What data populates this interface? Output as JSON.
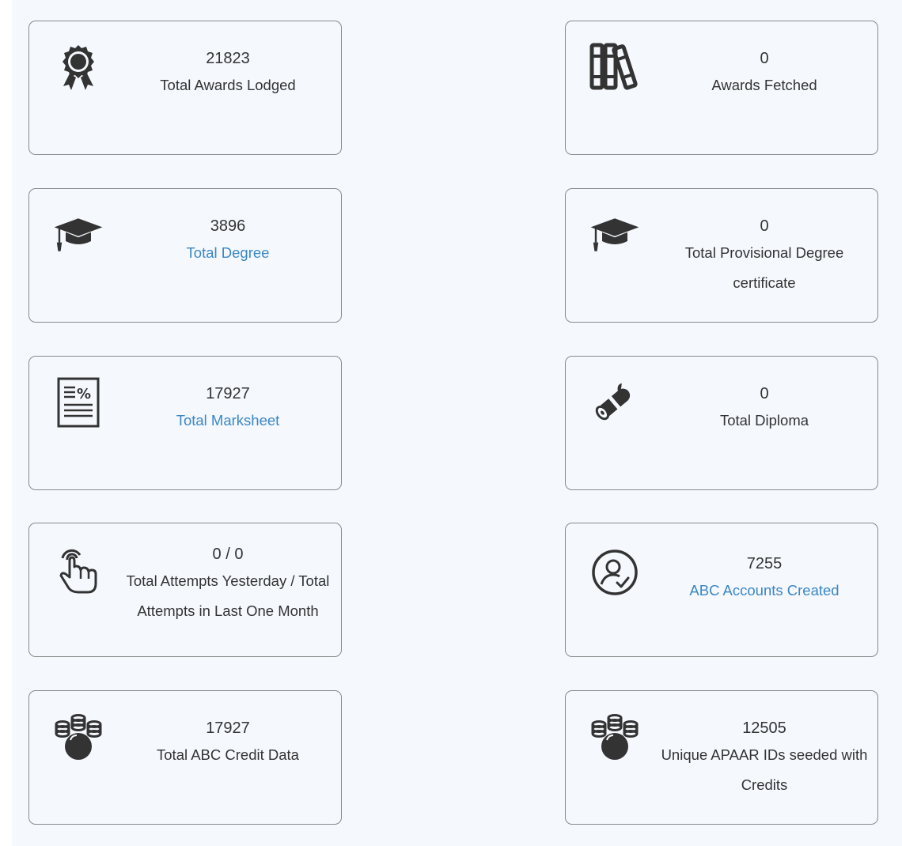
{
  "cards": [
    {
      "value": "21823",
      "label": "Total Awards Lodged",
      "icon": "award-ribbon-icon",
      "link": false
    },
    {
      "value": "0",
      "label": "Awards Fetched",
      "icon": "books-icon",
      "link": false
    },
    {
      "value": "3896",
      "label": "Total Degree",
      "icon": "graduation-cap-icon",
      "link": true
    },
    {
      "value": "0",
      "label": "Total Provisional Degree certificate",
      "icon": "graduation-cap-icon",
      "link": false
    },
    {
      "value": "17927",
      "label": "Total Marksheet",
      "icon": "marksheet-percent-icon",
      "link": true
    },
    {
      "value": "0",
      "label": "Total Diploma",
      "icon": "diploma-scroll-icon",
      "link": false
    },
    {
      "value": "0 / 0",
      "label": "Total Attempts Yesterday / Total Attempts in Last One Month",
      "icon": "pointer-hand-icon",
      "link": false
    },
    {
      "value": "7255",
      "label": "ABC Accounts Created",
      "icon": "user-check-circle-icon",
      "link": true
    },
    {
      "value": "17927",
      "label": "Total ABC Credit Data",
      "icon": "coins-icon",
      "link": false
    },
    {
      "value": "12505",
      "label": "Unique APAAR IDs seeded with Credits",
      "icon": "coins-icon",
      "link": false
    }
  ],
  "colors": {
    "text": "#333333",
    "link": "#3a87c5",
    "icon": "#333333",
    "card_border": "#8a8a8a",
    "background": "#f5f8fd"
  }
}
